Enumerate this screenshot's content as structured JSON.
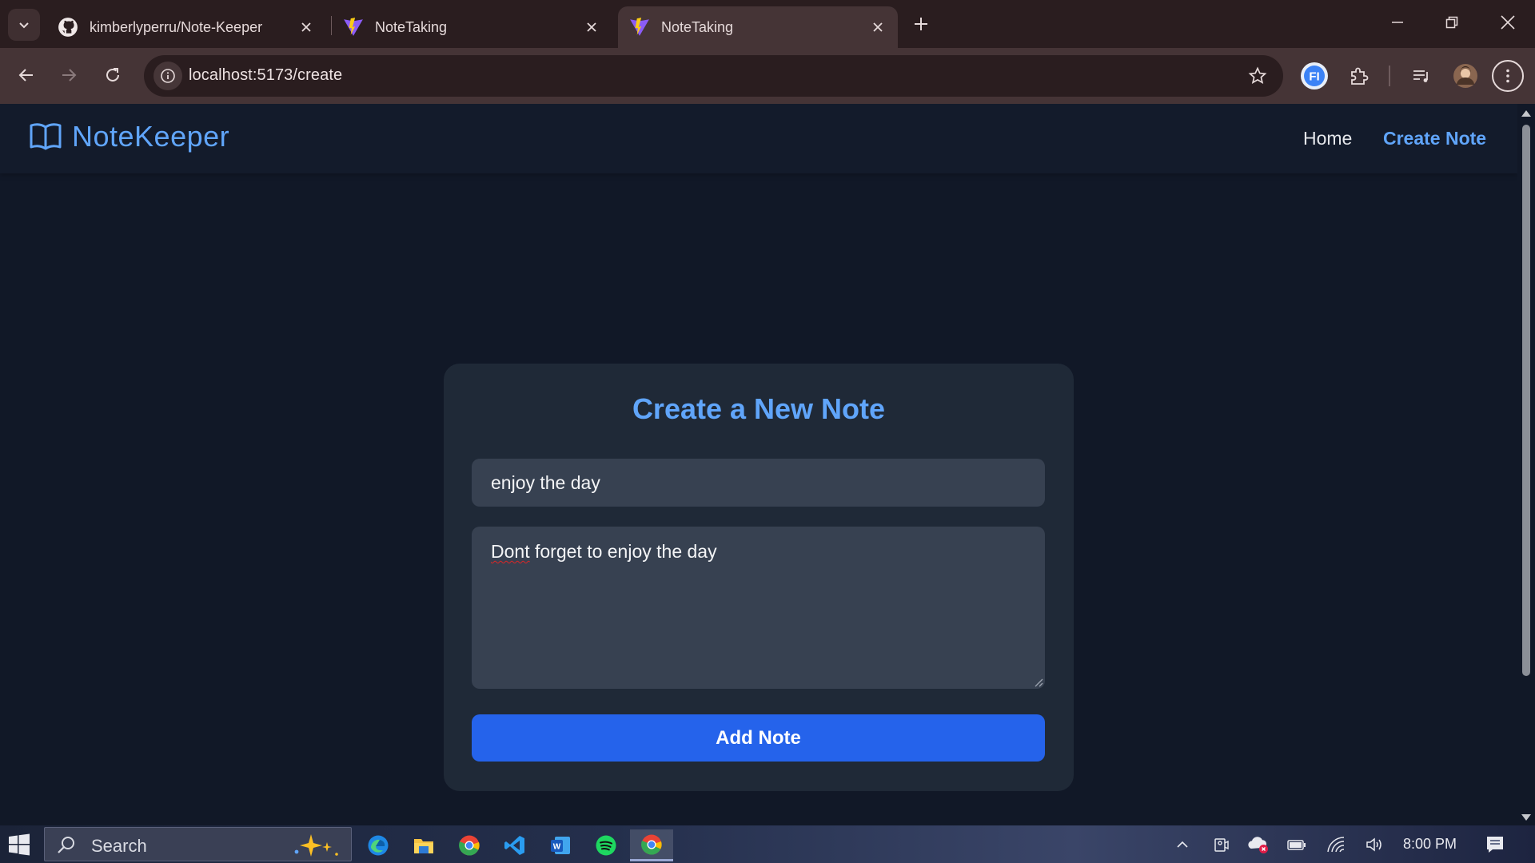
{
  "browser": {
    "tabs": [
      {
        "title": "kimberlyperru/Note-Keeper",
        "favicon": "github-icon",
        "active": false
      },
      {
        "title": "NoteTaking",
        "favicon": "vite-icon",
        "active": false
      },
      {
        "title": "NoteTaking",
        "favicon": "vite-icon",
        "active": true
      }
    ],
    "url": "localhost:5173/create",
    "extension_badge": "FI"
  },
  "page": {
    "brand": "NoteKeeper",
    "nav": {
      "home": "Home",
      "create": "Create Note"
    },
    "form": {
      "heading": "Create a New Note",
      "title_value": "enjoy the day",
      "body_typo": "Dont",
      "body_rest": " forget to enjoy the day",
      "submit_label": "Add Note"
    },
    "colors": {
      "accent": "#60a5fa",
      "button": "#2563eb",
      "card": "#1f2937",
      "background": "#111827"
    }
  },
  "taskbar": {
    "search_placeholder": "Search",
    "apps": [
      "edge-icon",
      "file-explorer-icon",
      "chrome-icon",
      "vscode-icon",
      "word-icon",
      "spotify-icon",
      "chrome-icon"
    ],
    "clock": "8:00 PM"
  }
}
